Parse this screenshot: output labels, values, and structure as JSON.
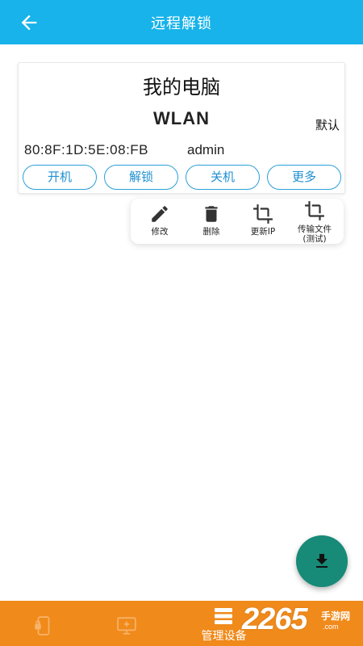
{
  "app_bar": {
    "title": "远程解锁",
    "back_icon": "arrow-left-icon",
    "background": "#17b3ea"
  },
  "device": {
    "name": "我的电脑",
    "connection": "WLAN",
    "default_label": "默认",
    "mac": "80:8F:1D:5E:08:FB",
    "user": "admin",
    "buttons": {
      "power_on": "开机",
      "unlock": "解锁",
      "shutdown": "关机",
      "more": "更多"
    },
    "accent": "#2a9fd8"
  },
  "more_menu": {
    "edit": {
      "label": "修改",
      "icon": "pencil-icon"
    },
    "delete": {
      "label": "删除",
      "icon": "trash-icon"
    },
    "update_ip": {
      "label": "更新IP",
      "icon": "crop-icon"
    },
    "transfer": {
      "label_line1": "传输文件",
      "label_line2": "(测试)",
      "icon": "crop-icon"
    }
  },
  "fab": {
    "icon": "download-icon",
    "color": "#178a78"
  },
  "bottom_nav": {
    "background": "#f08a1a",
    "items": [
      {
        "icon": "phone-lock-icon"
      },
      {
        "icon": "monitor-add-icon"
      },
      {
        "icon": "list-icon",
        "label": "管理设备"
      }
    ]
  },
  "watermark": {
    "number": "2265",
    "text": "手游网",
    "sub": ".com"
  }
}
